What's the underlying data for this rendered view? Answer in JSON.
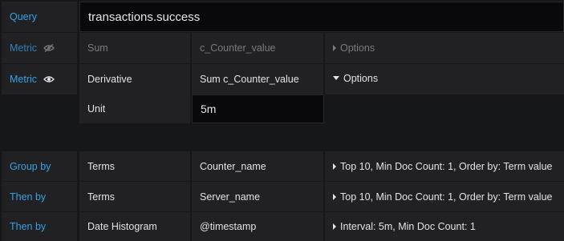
{
  "query": {
    "label": "Query",
    "value": "transactions.success"
  },
  "metrics": [
    {
      "label": "Metric",
      "visibility_icon": "eye-slash-icon",
      "type": "Sum",
      "field": "c_Counter_value",
      "options_label": "Options",
      "options_expanded": false
    },
    {
      "label": "Metric",
      "visibility_icon": "eye-icon",
      "type": "Derivative",
      "field": "Sum c_Counter_value",
      "options_label": "Options",
      "options_expanded": true,
      "unit": {
        "label": "Unit",
        "value": "5m"
      }
    }
  ],
  "group_by": [
    {
      "label": "Group by",
      "type": "Terms",
      "field": "Counter_name",
      "settings": "Top 10, Min Doc Count: 1, Order by: Term value"
    },
    {
      "label": "Then by",
      "type": "Terms",
      "field": "Server_name",
      "settings": "Top 10, Min Doc Count: 1, Order by: Term value"
    },
    {
      "label": "Then by",
      "type": "Date Histogram",
      "field": "@timestamp",
      "settings": "Interval: 5m, Min Doc Count: 1"
    }
  ],
  "colors": {
    "background": "#161719",
    "cell": "#212124",
    "label": "#33a2e5",
    "input": "#09090b"
  }
}
